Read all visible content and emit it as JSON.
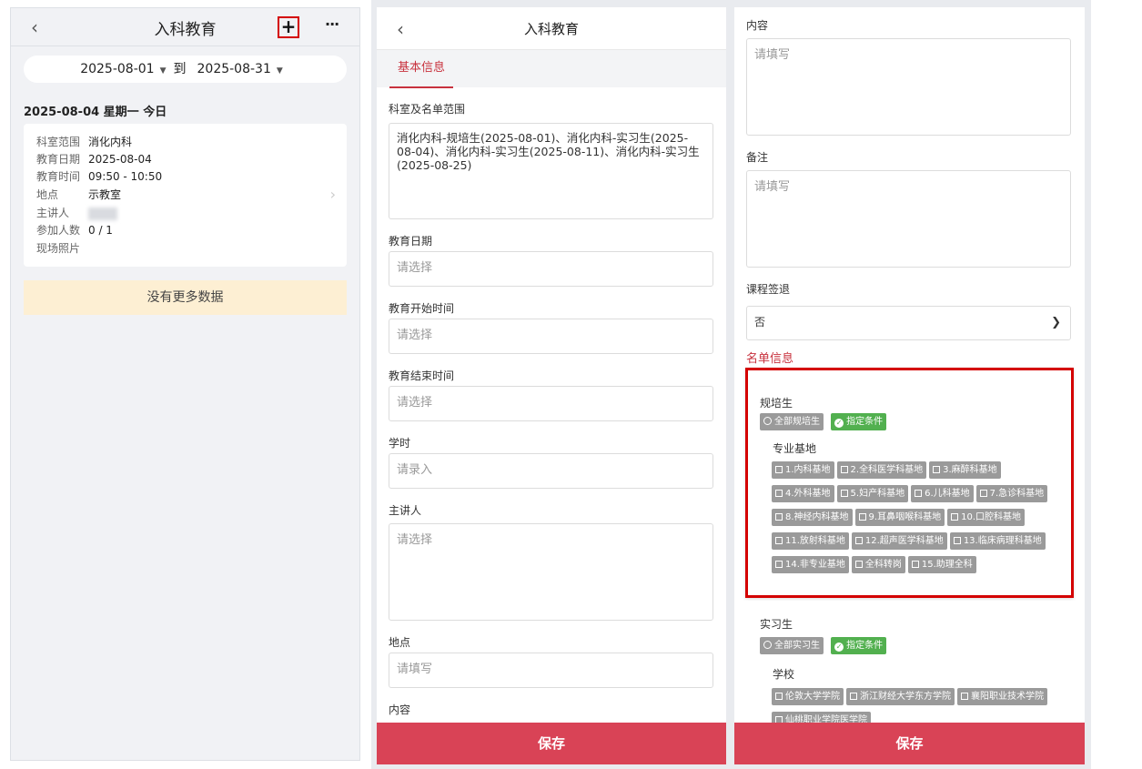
{
  "list_page": {
    "title": "入科教育",
    "back_icon": "‹",
    "add_icon": "+",
    "more_icon": "···",
    "date_start": "2025-08-01",
    "date_to": "到",
    "date_end": "2025-08-31",
    "day_header": "2025-08-04 星期一 今日",
    "card": {
      "rows": [
        {
          "key": "科室范围",
          "value": "消化内科"
        },
        {
          "key": "教育日期",
          "value": "2025-08-04"
        },
        {
          "key": "教育时间",
          "value": "09:50 - 10:50"
        },
        {
          "key": "地点",
          "value": "示教室"
        },
        {
          "key": "主讲人",
          "value": ""
        },
        {
          "key": "参加人数",
          "value": "0 / 1"
        },
        {
          "key": "现场照片",
          "value": ""
        }
      ]
    },
    "no_more": "没有更多数据"
  },
  "form_page": {
    "title": "入科教育",
    "tab": "基本信息",
    "fields": {
      "scope_label": "科室及名单范围",
      "scope_value": "消化内科-规培生(2025-08-01)、消化内科-实习生(2025-08-04)、消化内科-实习生(2025-08-11)、消化内科-实习生(2025-08-25)",
      "date_label": "教育日期",
      "date_ph": "请选择",
      "start_label": "教育开始时间",
      "start_ph": "请选择",
      "end_label": "教育结束时间",
      "end_ph": "请选择",
      "hours_label": "学时",
      "hours_ph": "请录入",
      "lecturer_label": "主讲人",
      "lecturer_ph": "请选择",
      "place_label": "地点",
      "place_ph": "请填写",
      "content_label": "内容"
    },
    "save": "保存"
  },
  "form_page_scrolled": {
    "content_label": "内容",
    "content_ph": "请填写",
    "remark_label": "备注",
    "remark_ph": "请填写",
    "signout_label": "课程签退",
    "signout_value": "否",
    "list_section": "名单信息",
    "resident": {
      "title": "规培生",
      "opt_all": "全部规培生",
      "opt_cond": "指定条件",
      "base_title": "专业基地",
      "bases": [
        "1.内科基地",
        "2.全科医学科基地",
        "3.麻醉科基地",
        "4.外科基地",
        "5.妇产科基地",
        "6.儿科基地",
        "7.急诊科基地",
        "8.神经内科基地",
        "9.耳鼻咽喉科基地",
        "10.口腔科基地",
        "11.放射科基地",
        "12.超声医学科基地",
        "13.临床病理科基地",
        "14.非专业基地",
        "全科转岗",
        "15.助理全科"
      ]
    },
    "intern": {
      "title": "实习生",
      "opt_all": "全部实习生",
      "opt_cond": "指定条件",
      "school_title": "学校",
      "schools": [
        "伦敦大学学院",
        "浙江财经大学东方学院",
        "襄阳职业技术学院",
        "仙桃职业学院医学院"
      ]
    },
    "save": "保存"
  }
}
